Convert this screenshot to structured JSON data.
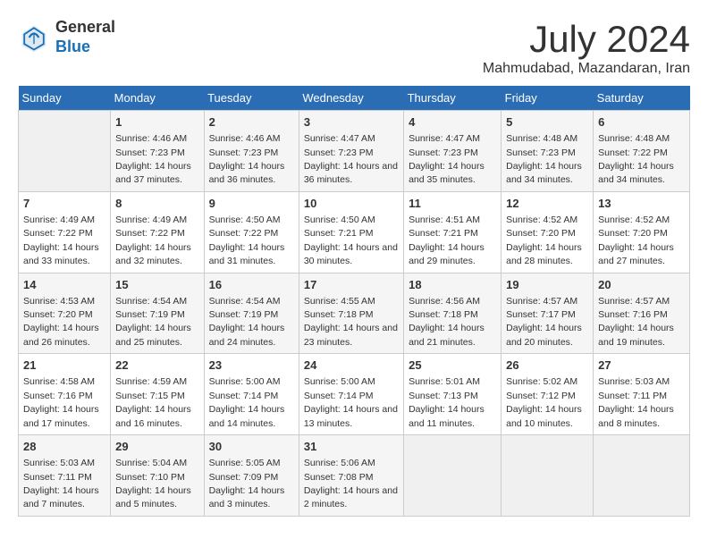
{
  "header": {
    "logo_general": "General",
    "logo_blue": "Blue",
    "title": "July 2024",
    "subtitle": "Mahmudabad, Mazandaran, Iran"
  },
  "days_of_week": [
    "Sunday",
    "Monday",
    "Tuesday",
    "Wednesday",
    "Thursday",
    "Friday",
    "Saturday"
  ],
  "weeks": [
    [
      {
        "day": "",
        "sunrise": "",
        "sunset": "",
        "daylight": ""
      },
      {
        "day": "1",
        "sunrise": "Sunrise: 4:46 AM",
        "sunset": "Sunset: 7:23 PM",
        "daylight": "Daylight: 14 hours and 37 minutes."
      },
      {
        "day": "2",
        "sunrise": "Sunrise: 4:46 AM",
        "sunset": "Sunset: 7:23 PM",
        "daylight": "Daylight: 14 hours and 36 minutes."
      },
      {
        "day": "3",
        "sunrise": "Sunrise: 4:47 AM",
        "sunset": "Sunset: 7:23 PM",
        "daylight": "Daylight: 14 hours and 36 minutes."
      },
      {
        "day": "4",
        "sunrise": "Sunrise: 4:47 AM",
        "sunset": "Sunset: 7:23 PM",
        "daylight": "Daylight: 14 hours and 35 minutes."
      },
      {
        "day": "5",
        "sunrise": "Sunrise: 4:48 AM",
        "sunset": "Sunset: 7:23 PM",
        "daylight": "Daylight: 14 hours and 34 minutes."
      },
      {
        "day": "6",
        "sunrise": "Sunrise: 4:48 AM",
        "sunset": "Sunset: 7:22 PM",
        "daylight": "Daylight: 14 hours and 34 minutes."
      }
    ],
    [
      {
        "day": "7",
        "sunrise": "Sunrise: 4:49 AM",
        "sunset": "Sunset: 7:22 PM",
        "daylight": "Daylight: 14 hours and 33 minutes."
      },
      {
        "day": "8",
        "sunrise": "Sunrise: 4:49 AM",
        "sunset": "Sunset: 7:22 PM",
        "daylight": "Daylight: 14 hours and 32 minutes."
      },
      {
        "day": "9",
        "sunrise": "Sunrise: 4:50 AM",
        "sunset": "Sunset: 7:22 PM",
        "daylight": "Daylight: 14 hours and 31 minutes."
      },
      {
        "day": "10",
        "sunrise": "Sunrise: 4:50 AM",
        "sunset": "Sunset: 7:21 PM",
        "daylight": "Daylight: 14 hours and 30 minutes."
      },
      {
        "day": "11",
        "sunrise": "Sunrise: 4:51 AM",
        "sunset": "Sunset: 7:21 PM",
        "daylight": "Daylight: 14 hours and 29 minutes."
      },
      {
        "day": "12",
        "sunrise": "Sunrise: 4:52 AM",
        "sunset": "Sunset: 7:20 PM",
        "daylight": "Daylight: 14 hours and 28 minutes."
      },
      {
        "day": "13",
        "sunrise": "Sunrise: 4:52 AM",
        "sunset": "Sunset: 7:20 PM",
        "daylight": "Daylight: 14 hours and 27 minutes."
      }
    ],
    [
      {
        "day": "14",
        "sunrise": "Sunrise: 4:53 AM",
        "sunset": "Sunset: 7:20 PM",
        "daylight": "Daylight: 14 hours and 26 minutes."
      },
      {
        "day": "15",
        "sunrise": "Sunrise: 4:54 AM",
        "sunset": "Sunset: 7:19 PM",
        "daylight": "Daylight: 14 hours and 25 minutes."
      },
      {
        "day": "16",
        "sunrise": "Sunrise: 4:54 AM",
        "sunset": "Sunset: 7:19 PM",
        "daylight": "Daylight: 14 hours and 24 minutes."
      },
      {
        "day": "17",
        "sunrise": "Sunrise: 4:55 AM",
        "sunset": "Sunset: 7:18 PM",
        "daylight": "Daylight: 14 hours and 23 minutes."
      },
      {
        "day": "18",
        "sunrise": "Sunrise: 4:56 AM",
        "sunset": "Sunset: 7:18 PM",
        "daylight": "Daylight: 14 hours and 21 minutes."
      },
      {
        "day": "19",
        "sunrise": "Sunrise: 4:57 AM",
        "sunset": "Sunset: 7:17 PM",
        "daylight": "Daylight: 14 hours and 20 minutes."
      },
      {
        "day": "20",
        "sunrise": "Sunrise: 4:57 AM",
        "sunset": "Sunset: 7:16 PM",
        "daylight": "Daylight: 14 hours and 19 minutes."
      }
    ],
    [
      {
        "day": "21",
        "sunrise": "Sunrise: 4:58 AM",
        "sunset": "Sunset: 7:16 PM",
        "daylight": "Daylight: 14 hours and 17 minutes."
      },
      {
        "day": "22",
        "sunrise": "Sunrise: 4:59 AM",
        "sunset": "Sunset: 7:15 PM",
        "daylight": "Daylight: 14 hours and 16 minutes."
      },
      {
        "day": "23",
        "sunrise": "Sunrise: 5:00 AM",
        "sunset": "Sunset: 7:14 PM",
        "daylight": "Daylight: 14 hours and 14 minutes."
      },
      {
        "day": "24",
        "sunrise": "Sunrise: 5:00 AM",
        "sunset": "Sunset: 7:14 PM",
        "daylight": "Daylight: 14 hours and 13 minutes."
      },
      {
        "day": "25",
        "sunrise": "Sunrise: 5:01 AM",
        "sunset": "Sunset: 7:13 PM",
        "daylight": "Daylight: 14 hours and 11 minutes."
      },
      {
        "day": "26",
        "sunrise": "Sunrise: 5:02 AM",
        "sunset": "Sunset: 7:12 PM",
        "daylight": "Daylight: 14 hours and 10 minutes."
      },
      {
        "day": "27",
        "sunrise": "Sunrise: 5:03 AM",
        "sunset": "Sunset: 7:11 PM",
        "daylight": "Daylight: 14 hours and 8 minutes."
      }
    ],
    [
      {
        "day": "28",
        "sunrise": "Sunrise: 5:03 AM",
        "sunset": "Sunset: 7:11 PM",
        "daylight": "Daylight: 14 hours and 7 minutes."
      },
      {
        "day": "29",
        "sunrise": "Sunrise: 5:04 AM",
        "sunset": "Sunset: 7:10 PM",
        "daylight": "Daylight: 14 hours and 5 minutes."
      },
      {
        "day": "30",
        "sunrise": "Sunrise: 5:05 AM",
        "sunset": "Sunset: 7:09 PM",
        "daylight": "Daylight: 14 hours and 3 minutes."
      },
      {
        "day": "31",
        "sunrise": "Sunrise: 5:06 AM",
        "sunset": "Sunset: 7:08 PM",
        "daylight": "Daylight: 14 hours and 2 minutes."
      },
      {
        "day": "",
        "sunrise": "",
        "sunset": "",
        "daylight": ""
      },
      {
        "day": "",
        "sunrise": "",
        "sunset": "",
        "daylight": ""
      },
      {
        "day": "",
        "sunrise": "",
        "sunset": "",
        "daylight": ""
      }
    ]
  ]
}
